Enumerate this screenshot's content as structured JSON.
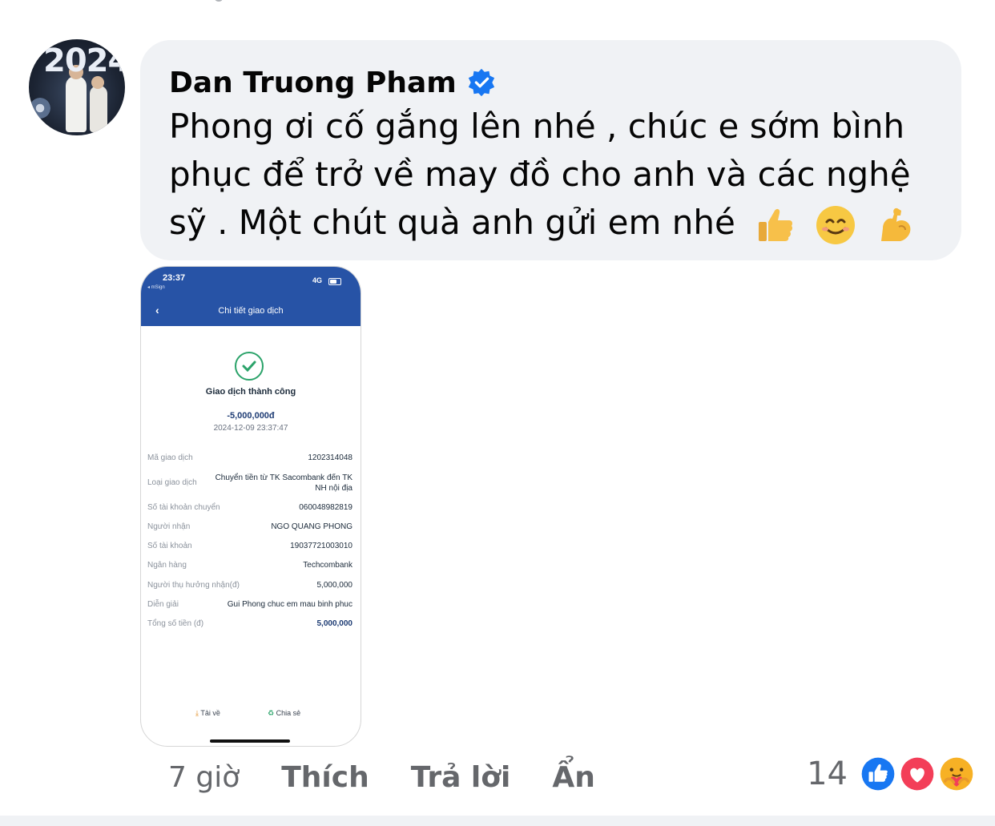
{
  "comment": {
    "author": "Dan Truong Pham",
    "verified_icon": "verified-badge-icon",
    "avatar_text": "2024",
    "text": "Phong ơi cố gắng lên nhé , chúc e sớm bình phục để trở về may đồ cho anh và các nghệ sỹ . Một chút quà anh gửi em nhé",
    "emojis": [
      "thumbs-up-emoji",
      "smiling-face-emoji",
      "flexed-biceps-emoji"
    ]
  },
  "attachment": {
    "status_time": "23:37",
    "status_app": "◂ mSign",
    "network": "4G",
    "screen_title": "Chi tiết giao dịch",
    "success_text": "Giao dịch thành công",
    "amount": "-5,000,000đ",
    "datetime": "2024-12-09 23:37:47",
    "details": [
      {
        "label": "Mã giao dịch",
        "value": "1202314048"
      },
      {
        "label": "Loại giao dịch",
        "value": "Chuyển tiền từ TK Sacombank đến TK NH nội địa"
      },
      {
        "label": "Số tài khoản chuyển",
        "value": "060048982819"
      },
      {
        "label": "Người nhận",
        "value": "NGO QUANG PHONG"
      },
      {
        "label": "Số tài khoản",
        "value": "19037721003010"
      },
      {
        "label": "Ngân hàng",
        "value": "Techcombank"
      },
      {
        "label": "Người thụ hưởng nhận(đ)",
        "value": "5,000,000"
      },
      {
        "label": "Diễn giải",
        "value": "Gui Phong chuc em mau binh phuc"
      },
      {
        "label": "Tổng số tiền (đ)",
        "value": "5,000,000"
      }
    ],
    "download_label": "Tải về",
    "share_label": "Chia sẻ"
  },
  "meta": {
    "time": "7 giờ",
    "like_label": "Thích",
    "reply_label": "Trả lời",
    "hide_label": "Ẩn"
  },
  "reactions": {
    "count": "14",
    "icons": [
      "like-reaction-icon",
      "love-reaction-icon",
      "care-reaction-icon"
    ],
    "colors": {
      "like": "#1877f2",
      "love": "#f33e58",
      "care": "#f7b125"
    }
  }
}
